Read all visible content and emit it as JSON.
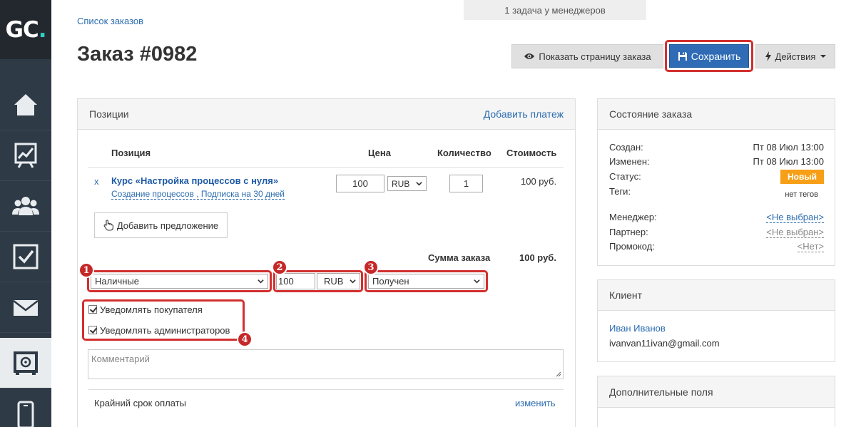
{
  "app": {
    "logo_text": "GC",
    "logo_dot": "."
  },
  "sidebar": {
    "items": [
      {
        "name": "home",
        "icon": "home-icon"
      },
      {
        "name": "stats",
        "icon": "chart-icon"
      },
      {
        "name": "users",
        "icon": "users-icon"
      },
      {
        "name": "tasks",
        "icon": "checkbox-icon"
      },
      {
        "name": "mail",
        "icon": "mail-icon"
      },
      {
        "name": "sales",
        "icon": "safe-icon",
        "active": true
      },
      {
        "name": "mobile",
        "icon": "phone-icon"
      }
    ]
  },
  "notice": {
    "text": "1 задача у менеджеров"
  },
  "breadcrumb": {
    "label": "Список заказов"
  },
  "page": {
    "title": "Заказ #0982"
  },
  "toolbar": {
    "show_page_label": "Показать страницу заказа",
    "save_label": "Сохранить",
    "actions_label": "Действия"
  },
  "positions": {
    "title": "Позиции",
    "add_payment": "Добавить платеж",
    "columns": {
      "item": "Позиция",
      "price": "Цена",
      "qty": "Количество",
      "cost": "Стоимость"
    },
    "row": {
      "remove": "x",
      "name": "Курс «Настройка процессов с нуля»",
      "sub": "Создание процессов , Подписка на 30 дней",
      "price": "100",
      "currency": "RUB",
      "qty": "1",
      "cost": "100 руб."
    },
    "add_offer": "Добавить предложение",
    "total_label": "Сумма заказа",
    "total_value": "100 руб."
  },
  "payment": {
    "method": "Наличные",
    "amount": "100",
    "currency": "RUB",
    "status": "Получен",
    "notify_buyer": "Уведомлять покупателя",
    "notify_admins": "Уведомлять администраторов",
    "comment_placeholder": "Комментарий",
    "deadline_label": "Крайний срок оплаты",
    "change_link": "изменить"
  },
  "annotations": [
    "1",
    "2",
    "3",
    "4"
  ],
  "state": {
    "title": "Состояние заказа",
    "created_label": "Создан:",
    "created_value": "Пт 08 Июл 13:00",
    "changed_label": "Изменен:",
    "changed_value": "Пт 08 Июл 13:00",
    "status_label": "Статус:",
    "status_value": "Новый",
    "tags_label": "Теги:",
    "tags_value": "нет тегов",
    "manager_label": "Менеджер:",
    "manager_value": "<Не выбран>",
    "partner_label": "Партнер:",
    "partner_value": "<Не выбран>",
    "promo_label": "Промокод:",
    "promo_value": "<Нет>"
  },
  "client": {
    "title": "Клиент",
    "name": "Иван Иванов",
    "email": "ivanvan11ivan@gmail.com"
  },
  "extra": {
    "title": "Дополнительные поля"
  },
  "colors": {
    "accent": "#2f6cb5",
    "highlight": "#d32f2f",
    "status_new": "#f79f17",
    "sidebar": "#2e3a46"
  }
}
